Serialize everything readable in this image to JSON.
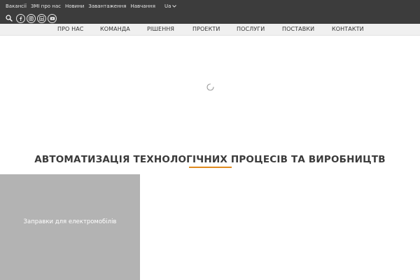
{
  "topbar": {
    "links": [
      "Вакансії",
      "ЗМІ про нас",
      "Новини",
      "Завантаження",
      "Навчання"
    ],
    "language": "Ua",
    "social": [
      "facebook-icon",
      "instagram-icon",
      "linkedin-icon",
      "youtube-icon"
    ]
  },
  "nav": {
    "items": [
      "ПРО НАС",
      "КОМАНДА",
      "РІШЕННЯ",
      "ПРОЕКТИ",
      "ПОСЛУГИ",
      "ПОСТАВКИ",
      "КОНТАКТИ"
    ]
  },
  "section": {
    "title": "АВТОМАТИЗАЦІЯ ТЕХНОЛОГІЧНИХ ПРОЦЕСІВ ТА ВИРОБНИЦТВ"
  },
  "tiles": [
    {
      "label": "Заправки для електромобілів"
    }
  ],
  "colors": {
    "topbar": "#3c3c3c",
    "nav_background": "#f0f0f0",
    "accent": "#e08a1e",
    "tile": "#b3b3b3"
  }
}
